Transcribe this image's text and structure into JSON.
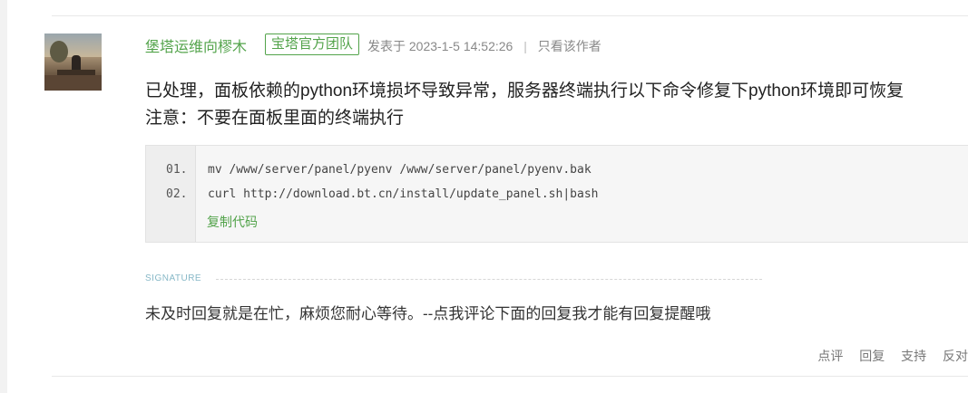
{
  "post": {
    "author": "堡塔运维向樛木",
    "badge": "宝塔官方团队",
    "posted_at": "发表于 2023-1-5 14:52:26",
    "separator": "|",
    "only_author": "只看该作者",
    "lines": [
      "已处理，面板依赖的python环境损坏导致异常，服务器终端执行以下命令修复下python环境即可恢复",
      "注意：不要在面板里面的终端执行"
    ]
  },
  "code": {
    "line_numbers": [
      "01.",
      "02."
    ],
    "lines": [
      "mv /www/server/panel/pyenv /www/server/panel/pyenv.bak",
      "curl http://download.bt.cn/install/update_panel.sh|bash"
    ],
    "copy_label": "复制代码"
  },
  "signature": {
    "label": "SIGNATURE",
    "text": "未及时回复就是在忙，麻烦您耐心等待。--点我评论下面的回复我才能有回复提醒哦"
  },
  "actions": [
    "点评",
    "回复",
    "支持",
    "反对"
  ],
  "colors": {
    "accent_green": "#52a34a",
    "signature_blue": "#87b8c7"
  },
  "icons": {
    "avatar": "avatar-image"
  }
}
